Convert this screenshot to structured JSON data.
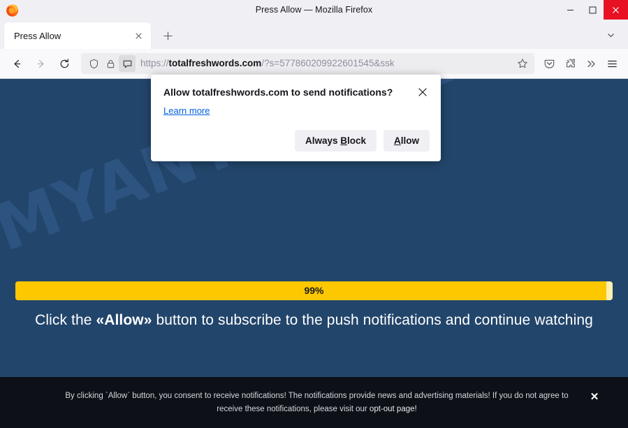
{
  "window": {
    "title": "Press Allow — Mozilla Firefox",
    "minimize_label": "Minimize",
    "maximize_label": "Maximize",
    "close_label": "Close"
  },
  "tabbar": {
    "tab_title": "Press Allow",
    "tab_close_label": "Close tab",
    "new_tab_label": "New tab",
    "list_all_tabs_label": "List all tabs"
  },
  "navbar": {
    "back_label": "Go back one page",
    "forward_label": "Go forward one page",
    "reload_label": "Reload current page",
    "url_scheme": "https://",
    "url_host": "totalfreshwords.com",
    "url_path": "/?s=577860209922601545&ssk",
    "url_full": "https://totalfreshwords.com/?s=577860209922601545&ssk",
    "bookmark_label": "Bookmark this page",
    "pocket_label": "Save to Pocket",
    "extensions_label": "Extensions",
    "overflow_label": "More tools",
    "appmenu_label": "Open application menu"
  },
  "permission_popup": {
    "title": "Allow totalfreshwords.com to send notifications?",
    "close_label": "Close",
    "learn_more": "Learn more",
    "block_button": {
      "prefix": "Always ",
      "accesskey": "B",
      "suffix": "lock"
    },
    "allow_button": {
      "accesskey": "A",
      "suffix": "llow"
    }
  },
  "page": {
    "watermark": "MYANTISPYWARE.COM",
    "progress_percent": "99%",
    "progress_value": 99,
    "headline_before": "Click the ",
    "headline_emphasis": "«Allow»",
    "headline_after": " button to subscribe to the push notifications and continue watching",
    "background_color": "#22456b",
    "progress_fill_color": "#fdc800",
    "progress_track_color": "#fff0b0"
  },
  "consent_banner": {
    "text_before": "By clicking `Allow` button, you consent to receive notifications! The notifications provide news and advertising materials! If you do not agree to receive these notifications, please visit our ",
    "link_text": "opt-out page!",
    "close_label": "✕",
    "background_color": "#0d1117"
  }
}
